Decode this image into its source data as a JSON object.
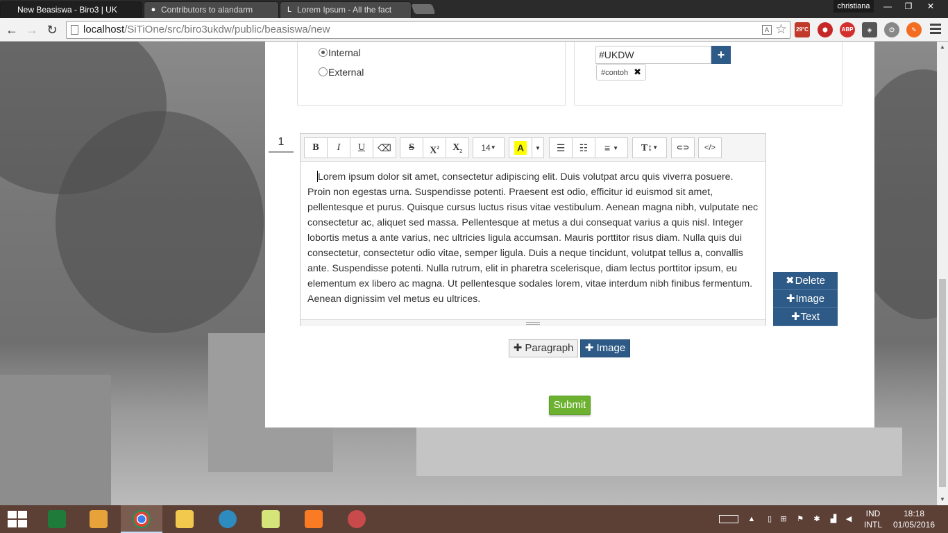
{
  "browser": {
    "tabs": [
      {
        "title": "New Beasiswa - Biro3 | UK",
        "active": true
      },
      {
        "title": "Contributors to alandarm",
        "active": false
      },
      {
        "title": "Lorem Ipsum - All the fact",
        "active": false
      }
    ],
    "profile_name": "christiana",
    "url_host": "localhost",
    "url_path": "/SiTiOne/src/biro3ukdw/public/beasiswa/new",
    "weather_badge": "29°C",
    "abp_badge": "ABP"
  },
  "form": {
    "radio_options": [
      {
        "label": "Internal",
        "checked": true
      },
      {
        "label": "External",
        "checked": false
      }
    ],
    "tag_input_value": "#UKDW",
    "tag_add_label": "+",
    "tags": [
      "#contoh"
    ],
    "tag_remove_label": "✖",
    "paragraph_number": "1",
    "toolbar": {
      "bold": "B",
      "italic": "I",
      "underline": "U",
      "eraser": "⌫",
      "strike": "S",
      "superscript": "X",
      "subscript": "X",
      "font_size": "14",
      "color": "A",
      "ul": "☰",
      "ol": "☷",
      "align": "≡",
      "height": "T↕",
      "link": "⊂⊃",
      "code": "</>"
    },
    "editor_text": "Lorem ipsum dolor sit amet, consectetur adipiscing elit. Duis volutpat arcu quis viverra posuere. Proin non egestas urna. Suspendisse potenti. Praesent est odio, efficitur id euismod sit amet, pellentesque et purus. Quisque cursus luctus risus vitae vestibulum. Aenean magna nibh, vulputate nec consectetur ac, aliquet sed massa. Pellentesque at metus a dui consequat varius a quis nisl. Integer lobortis metus a ante varius, nec ultricies ligula accumsan. Mauris porttitor risus diam. Nulla quis dui consectetur, consectetur odio vitae, semper ligula. Duis a neque tincidunt, volutpat tellus a, convallis ante. Suspendisse potenti. Nulla rutrum, elit in pharetra scelerisque, diam lectus porttitor ipsum, eu elementum ex libero ac magna. Ut pellentesque sodales lorem, vitae interdum nibh finibus fermentum. Aenean dignissim vel metus eu ultrices.",
    "side_actions": {
      "delete": "Delete",
      "image": "Image",
      "text": "Text"
    },
    "add_paragraph_label": "Paragraph",
    "add_image_label": "Image",
    "submit_label": "Submit"
  },
  "taskbar": {
    "lang_top": "IND",
    "lang_bottom": "INTL",
    "time": "18:18",
    "date": "01/05/2016"
  },
  "colors": {
    "accent_blue": "#2d5a86",
    "submit_green": "#6cb12f",
    "taskbar": "#5c4036"
  }
}
